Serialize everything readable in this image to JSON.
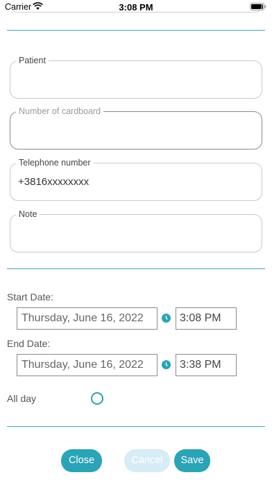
{
  "status_bar": {
    "carrier": "Carrier",
    "time": "3:08 PM"
  },
  "form": {
    "patient": {
      "label": "Patient",
      "value": ""
    },
    "cardboard": {
      "label": "Number of cardboard",
      "value": ""
    },
    "telephone": {
      "label": "Telephone number",
      "value": "+3816xxxxxxxx"
    },
    "note": {
      "label": "Note",
      "value": ""
    }
  },
  "schedule": {
    "start_label": "Start Date:",
    "start_date": "Thursday, June 16, 2022",
    "start_time": "3:08 PM",
    "end_label": "End Date:",
    "end_date": "Thursday, June 16, 2022",
    "end_time": "3:38 PM",
    "all_day_label": "All day"
  },
  "actions": {
    "close": "Close",
    "cancel": "Cancel",
    "save": "Save"
  },
  "colors": {
    "accent": "#2aa4b6",
    "divider": "#3fa9b6",
    "disabled": "#d8ecf6"
  }
}
